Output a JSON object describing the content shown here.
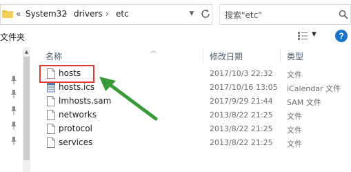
{
  "address_bar": {
    "overflow": "«",
    "crumbs": [
      "System32",
      "drivers",
      "etc"
    ],
    "separator": "›"
  },
  "search": {
    "placeholder": "搜索\"etc\""
  },
  "toolbar": {
    "organize_label": "文件夹",
    "help": "?"
  },
  "columns": {
    "name": "名称",
    "date": "修改日期",
    "type": "类型"
  },
  "files": [
    {
      "name": "hosts",
      "date": "2017/10/3 22:32",
      "type": "文件",
      "icon": "blank-file-icon"
    },
    {
      "name": "hosts.ics",
      "date": "2017/10/16 13:05",
      "type": "iCalendar 文件",
      "icon": "calendar-file-icon"
    },
    {
      "name": "lmhosts.sam",
      "date": "2017/9/29 21:44",
      "type": "SAM 文件",
      "icon": "blank-file-icon"
    },
    {
      "name": "networks",
      "date": "2013/8/22 21:25",
      "type": "文件",
      "icon": "blank-file-icon"
    },
    {
      "name": "protocol",
      "date": "2013/8/22 21:25",
      "type": "文件",
      "icon": "blank-file-icon"
    },
    {
      "name": "services",
      "date": "2013/8/22 21:25",
      "type": "文件",
      "icon": "blank-file-icon"
    }
  ],
  "colors": {
    "highlight": "#e53935",
    "annotation_arrow": "#3a9a3a",
    "help_button": "#1a73c8"
  }
}
